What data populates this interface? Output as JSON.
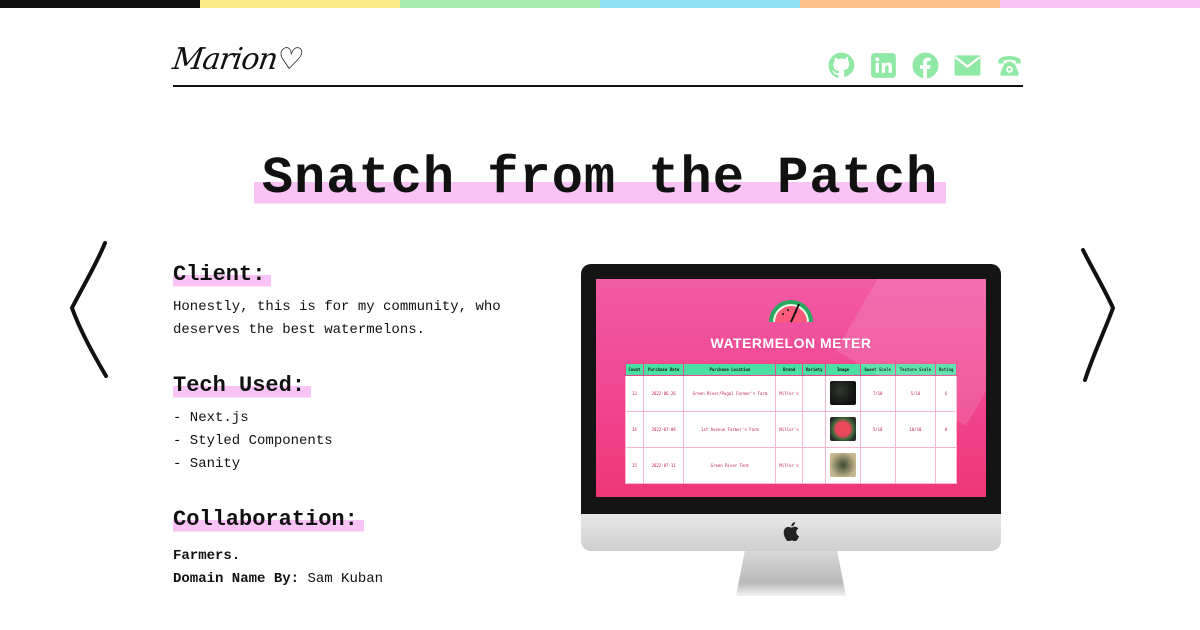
{
  "colors": {
    "topbar": [
      "#111111",
      "#fbe985",
      "#a7ecb0",
      "#8fe3f4",
      "#fbc28b",
      "#f9c3f6"
    ],
    "accent": "#f9c3f6",
    "social": "#8fe8a4",
    "screen_pink": "#f0458f",
    "table_header": "#4be0a2"
  },
  "header": {
    "logo": "Marion♡",
    "socials": [
      {
        "icon": "github-icon"
      },
      {
        "icon": "linkedin-icon"
      },
      {
        "icon": "facebook-icon"
      },
      {
        "icon": "mail-icon"
      },
      {
        "icon": "phone-icon"
      }
    ]
  },
  "title": "Snatch from the Patch",
  "client": {
    "heading": "Client:",
    "text": "Honestly, this is for my community, who deserves the best watermelons."
  },
  "tech": {
    "heading": "Tech Used:",
    "items": [
      "- Next.js",
      "- Styled Components",
      "- Sanity"
    ]
  },
  "collab": {
    "heading": "Collaboration:",
    "line1": "Farmers.",
    "line2_label": "Domain Name By:",
    "line2_value": "Sam Kuban"
  },
  "screenshot": {
    "app_title": "WATERMELON METER",
    "apple_logo": "",
    "columns": [
      "Count",
      "Purchase Date",
      "Purchase Location",
      "Brand",
      "Variety",
      "Image",
      "Sweet Scale",
      "Texture Scale",
      "Rating"
    ],
    "rows": [
      [
        "13",
        "2022-06-26",
        "Green River/Pugal Farmer's Farm",
        "Miller's",
        "",
        "",
        "7/10",
        "5/10",
        "6"
      ],
      [
        "14",
        "2022-07-09",
        "1st Avenue Farmer's Farm",
        "Miller's",
        "",
        "",
        "5/10",
        "10/10",
        "8"
      ],
      [
        "15",
        "2022-07-11",
        "Green River Tent",
        "Miller's",
        "",
        "",
        "",
        "",
        ""
      ]
    ]
  }
}
